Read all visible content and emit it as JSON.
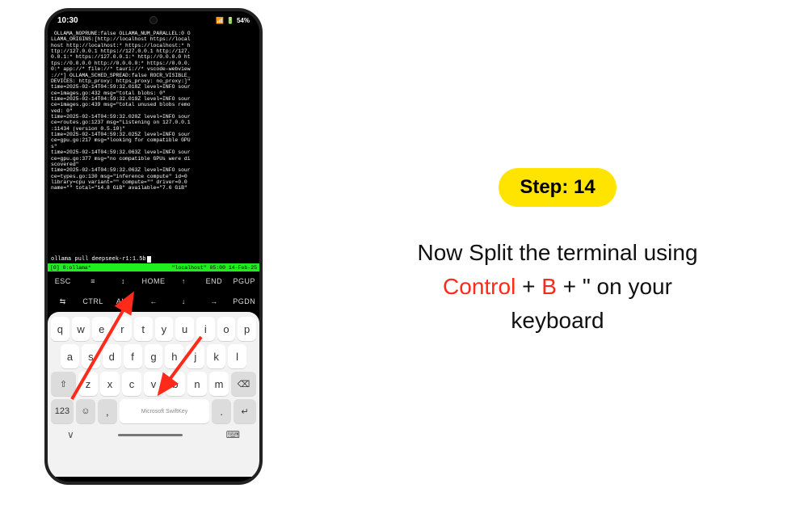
{
  "status": {
    "time": "10:30",
    "battery": "54%",
    "net_icons": "·· ᯤ ▲ ⎍ 54%"
  },
  "terminal": {
    "log": " OLLAMA_NOPRUNE:false OLLAMA_NUM_PARALLEL:0 O\nLLAMA_ORIGINS:[http://localhost https://local\nhost http://localhost:* https://localhost:* h\nttp://127.0.0.1 https://127.0.0.1 http://127.\n0.0.1:* https://127.0.0.1:* http://0.0.0.0 ht\ntps://0.0.0.0 http://0.0.0.0:* https://0.0.0.\n0:* app://* file://* tauri://* vscode-webview\n://*] OLLAMA_SCHED_SPREAD:false ROCR_VISIBLE_\nDEVICES: http_proxy: https_proxy: no_proxy:]\"\ntime=2025-02-14T04:59:32.018Z level=INFO sour\nce=images.go:432 msg=\"total blobs: 0\"\ntime=2025-02-14T04:59:32.019Z level=INFO sour\nce=images.go:439 msg=\"total unused blobs remo\nved: 0\"\ntime=2025-02-14T04:59:32.020Z level=INFO sour\nce=routes.go:1237 msg=\"Listening on 127.0.0.1\n:11434 (version 0.5.10)\"\ntime=2025-02-14T04:59:32.025Z level=INFO sour\nce=gpu.go:217 msg=\"looking for compatible GPU\ns\"\ntime=2025-02-14T04:59:32.063Z level=INFO sour\nce=gpu.go:377 msg=\"no compatible GPUs were di\nscovered\"\ntime=2025-02-14T04:59:32.063Z level=INFO sour\nce=types.go:130 msg=\"inference compute\" id=0 \nlibrary=cpu variant=\"\" compute=\"\" driver=0.0 \nname=\"\" total=\"14.8 GiB\" available=\"7.6 GiB\"\n",
    "command": "ollama pull deepseek-r1:1.5b",
    "tmux_left": "[0] 0:ollama*",
    "tmux_right": "\"localhost\" 05:00 14-Feb-25"
  },
  "fnrows": {
    "r1": {
      "esc": "ESC",
      "menu": "≡",
      "ud": "↕",
      "home": "HOME",
      "up": "↑",
      "end": "END",
      "pgup": "PGUP"
    },
    "r2": {
      "tab": "⇆",
      "ctrl": "CTRL",
      "alt": "ALT",
      "left": "←",
      "down": "↓",
      "right": "→",
      "pgdn": "PGDN"
    }
  },
  "keys": {
    "row1": [
      "q",
      "w",
      "e",
      "r",
      "t",
      "y",
      "u",
      "i",
      "o",
      "p"
    ],
    "row2": [
      "a",
      "s",
      "d",
      "f",
      "g",
      "h",
      "j",
      "k",
      "l"
    ],
    "row3_shift": "⇧",
    "row3": [
      "z",
      "x",
      "c",
      "v",
      "b",
      "n",
      "m"
    ],
    "row3_back": "⌫",
    "row4_123": "123",
    "row4_emoji": "☺",
    "row4_comma": ",",
    "row4_space": "Microsoft SwiftKey",
    "row4_period": ".",
    "row4_enter": "↵"
  },
  "nav": {
    "back": "∨",
    "kbd": "⌨"
  },
  "step": {
    "badge_prefix": "Step: ",
    "number": "14",
    "line1": "Now Split the terminal using ",
    "hot1": "Control",
    "plus1": " + ",
    "hot2": "B",
    "plus2": " + \" on your ",
    "line3": "keyboard"
  }
}
